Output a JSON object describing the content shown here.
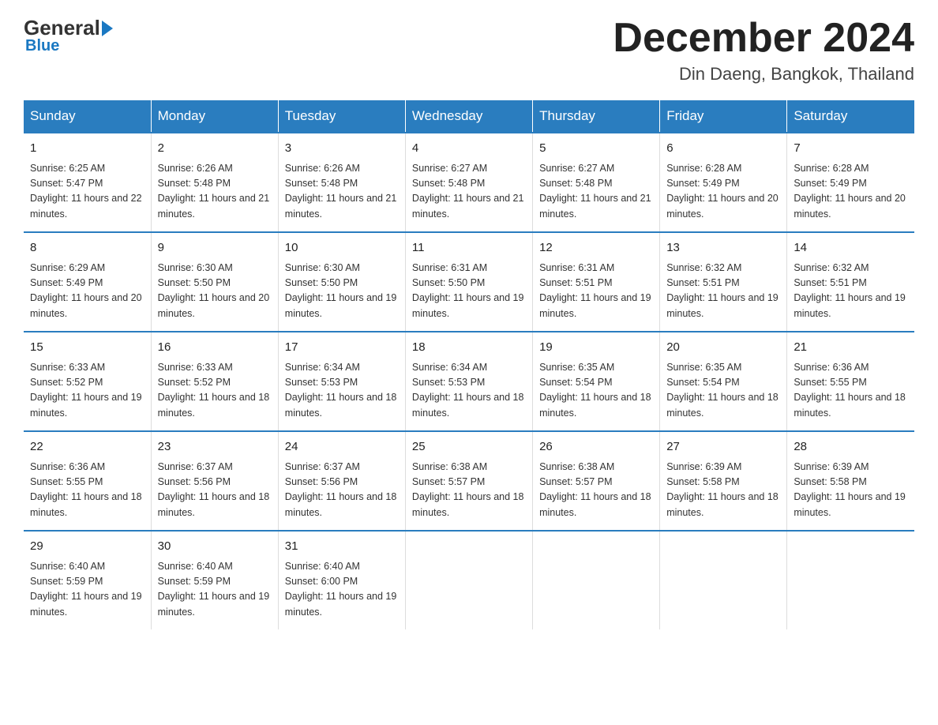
{
  "logo": {
    "general": "General",
    "blue": "Blue"
  },
  "header": {
    "month": "December 2024",
    "location": "Din Daeng, Bangkok, Thailand"
  },
  "days_header": [
    "Sunday",
    "Monday",
    "Tuesday",
    "Wednesday",
    "Thursday",
    "Friday",
    "Saturday"
  ],
  "weeks": [
    [
      {
        "day": "1",
        "sunrise": "6:25 AM",
        "sunset": "5:47 PM",
        "daylight": "11 hours and 22 minutes."
      },
      {
        "day": "2",
        "sunrise": "6:26 AM",
        "sunset": "5:48 PM",
        "daylight": "11 hours and 21 minutes."
      },
      {
        "day": "3",
        "sunrise": "6:26 AM",
        "sunset": "5:48 PM",
        "daylight": "11 hours and 21 minutes."
      },
      {
        "day": "4",
        "sunrise": "6:27 AM",
        "sunset": "5:48 PM",
        "daylight": "11 hours and 21 minutes."
      },
      {
        "day": "5",
        "sunrise": "6:27 AM",
        "sunset": "5:48 PM",
        "daylight": "11 hours and 21 minutes."
      },
      {
        "day": "6",
        "sunrise": "6:28 AM",
        "sunset": "5:49 PM",
        "daylight": "11 hours and 20 minutes."
      },
      {
        "day": "7",
        "sunrise": "6:28 AM",
        "sunset": "5:49 PM",
        "daylight": "11 hours and 20 minutes."
      }
    ],
    [
      {
        "day": "8",
        "sunrise": "6:29 AM",
        "sunset": "5:49 PM",
        "daylight": "11 hours and 20 minutes."
      },
      {
        "day": "9",
        "sunrise": "6:30 AM",
        "sunset": "5:50 PM",
        "daylight": "11 hours and 20 minutes."
      },
      {
        "day": "10",
        "sunrise": "6:30 AM",
        "sunset": "5:50 PM",
        "daylight": "11 hours and 19 minutes."
      },
      {
        "day": "11",
        "sunrise": "6:31 AM",
        "sunset": "5:50 PM",
        "daylight": "11 hours and 19 minutes."
      },
      {
        "day": "12",
        "sunrise": "6:31 AM",
        "sunset": "5:51 PM",
        "daylight": "11 hours and 19 minutes."
      },
      {
        "day": "13",
        "sunrise": "6:32 AM",
        "sunset": "5:51 PM",
        "daylight": "11 hours and 19 minutes."
      },
      {
        "day": "14",
        "sunrise": "6:32 AM",
        "sunset": "5:51 PM",
        "daylight": "11 hours and 19 minutes."
      }
    ],
    [
      {
        "day": "15",
        "sunrise": "6:33 AM",
        "sunset": "5:52 PM",
        "daylight": "11 hours and 19 minutes."
      },
      {
        "day": "16",
        "sunrise": "6:33 AM",
        "sunset": "5:52 PM",
        "daylight": "11 hours and 18 minutes."
      },
      {
        "day": "17",
        "sunrise": "6:34 AM",
        "sunset": "5:53 PM",
        "daylight": "11 hours and 18 minutes."
      },
      {
        "day": "18",
        "sunrise": "6:34 AM",
        "sunset": "5:53 PM",
        "daylight": "11 hours and 18 minutes."
      },
      {
        "day": "19",
        "sunrise": "6:35 AM",
        "sunset": "5:54 PM",
        "daylight": "11 hours and 18 minutes."
      },
      {
        "day": "20",
        "sunrise": "6:35 AM",
        "sunset": "5:54 PM",
        "daylight": "11 hours and 18 minutes."
      },
      {
        "day": "21",
        "sunrise": "6:36 AM",
        "sunset": "5:55 PM",
        "daylight": "11 hours and 18 minutes."
      }
    ],
    [
      {
        "day": "22",
        "sunrise": "6:36 AM",
        "sunset": "5:55 PM",
        "daylight": "11 hours and 18 minutes."
      },
      {
        "day": "23",
        "sunrise": "6:37 AM",
        "sunset": "5:56 PM",
        "daylight": "11 hours and 18 minutes."
      },
      {
        "day": "24",
        "sunrise": "6:37 AM",
        "sunset": "5:56 PM",
        "daylight": "11 hours and 18 minutes."
      },
      {
        "day": "25",
        "sunrise": "6:38 AM",
        "sunset": "5:57 PM",
        "daylight": "11 hours and 18 minutes."
      },
      {
        "day": "26",
        "sunrise": "6:38 AM",
        "sunset": "5:57 PM",
        "daylight": "11 hours and 18 minutes."
      },
      {
        "day": "27",
        "sunrise": "6:39 AM",
        "sunset": "5:58 PM",
        "daylight": "11 hours and 18 minutes."
      },
      {
        "day": "28",
        "sunrise": "6:39 AM",
        "sunset": "5:58 PM",
        "daylight": "11 hours and 19 minutes."
      }
    ],
    [
      {
        "day": "29",
        "sunrise": "6:40 AM",
        "sunset": "5:59 PM",
        "daylight": "11 hours and 19 minutes."
      },
      {
        "day": "30",
        "sunrise": "6:40 AM",
        "sunset": "5:59 PM",
        "daylight": "11 hours and 19 minutes."
      },
      {
        "day": "31",
        "sunrise": "6:40 AM",
        "sunset": "6:00 PM",
        "daylight": "11 hours and 19 minutes."
      },
      null,
      null,
      null,
      null
    ]
  ]
}
